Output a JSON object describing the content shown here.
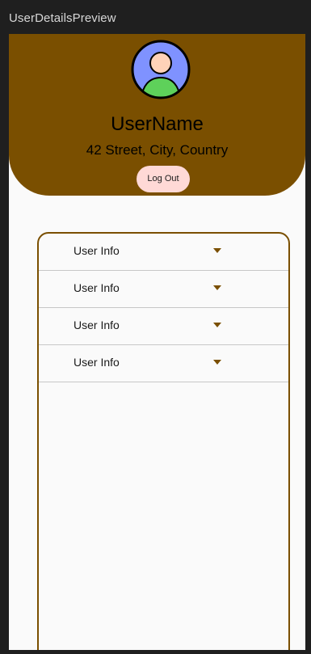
{
  "window": {
    "title": "UserDetailsPreview"
  },
  "profile": {
    "avatar_icon": "user-avatar-icon",
    "username": "UserName",
    "address": "42 Street, City, Country",
    "logout_label": "Log Out"
  },
  "info_list": {
    "items": [
      {
        "label": "User Info",
        "icon": "chevron-down-icon"
      },
      {
        "label": "User Info",
        "icon": "chevron-down-icon"
      },
      {
        "label": "User Info",
        "icon": "chevron-down-icon"
      },
      {
        "label": "User Info",
        "icon": "chevron-down-icon"
      }
    ]
  },
  "colors": {
    "header_background": "#7a4f00",
    "logout_background": "#ffd9d6",
    "avatar_background": "#7f92ff",
    "avatar_body": "#5ed15a",
    "avatar_face": "#ffd2b8",
    "accent": "#7a4f00"
  }
}
